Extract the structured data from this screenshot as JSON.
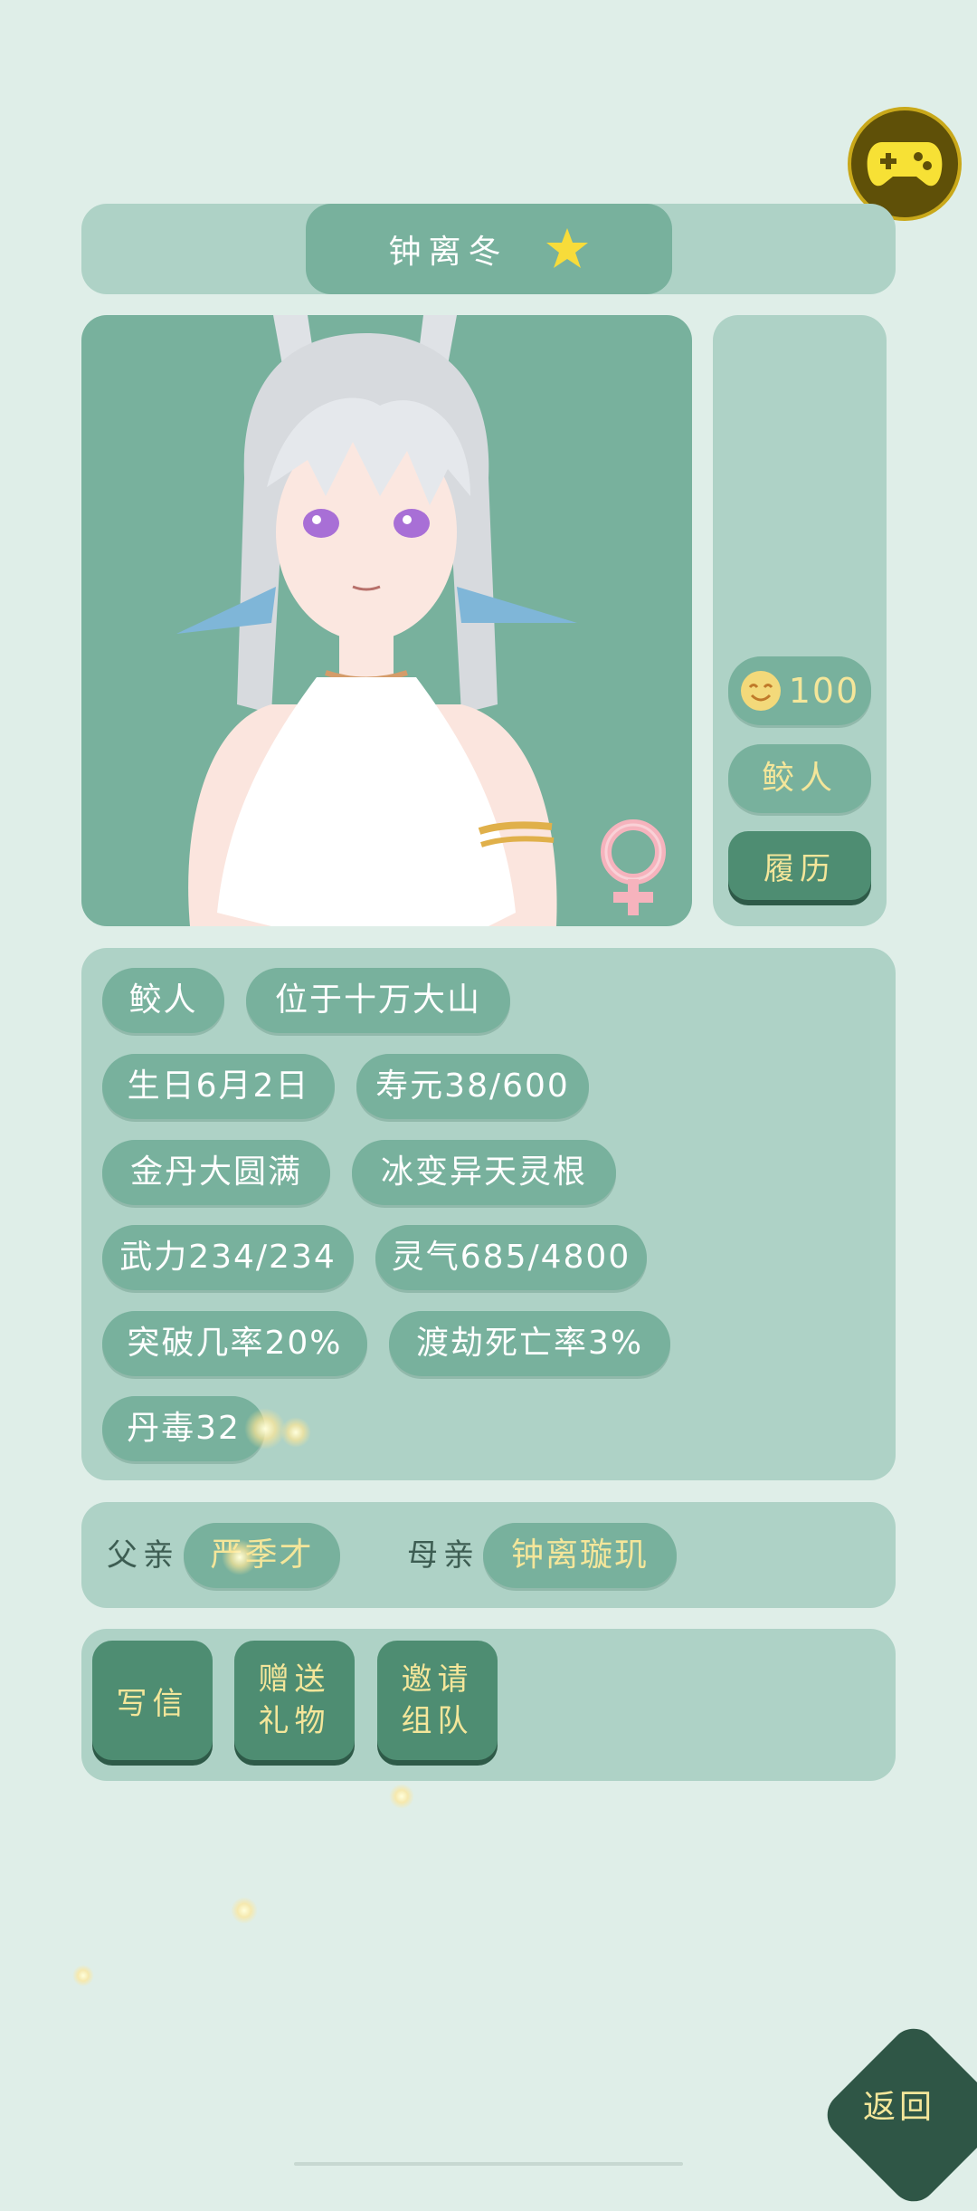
{
  "character": {
    "name": "钟离冬",
    "star_icon": "star-icon",
    "gender_icon": "female-symbol-icon",
    "mood": {
      "icon": "smiling-face-icon",
      "value": "100"
    },
    "race_button": "鲛人",
    "history_button": "履历"
  },
  "attributes": [
    [
      "鲛人",
      "位于十万大山"
    ],
    [
      "生日6月2日",
      "寿元38/600"
    ],
    [
      "金丹大圆满",
      "冰变异天灵根"
    ],
    [
      "武力234/234",
      "灵气685/4800"
    ],
    [
      "突破几率20%",
      "渡劫死亡率3%"
    ],
    [
      "丹毒32"
    ]
  ],
  "family": {
    "father_label": "父亲",
    "father_name": "严季才",
    "mother_label": "母亲",
    "mother_name": "钟离璇玑"
  },
  "actions": {
    "write_letter": "写信",
    "send_gift_line1": "赠送",
    "send_gift_line2": "礼物",
    "invite_line1": "邀请",
    "invite_line2": "组队"
  },
  "back_button": "返回",
  "colors": {
    "background": "#dfeee8",
    "panel": "#aed2c6",
    "pill": "#78b19d",
    "dark_button": "#4e8d72",
    "accent_yellow": "#f4e69a",
    "back_button": "#2f5646"
  }
}
